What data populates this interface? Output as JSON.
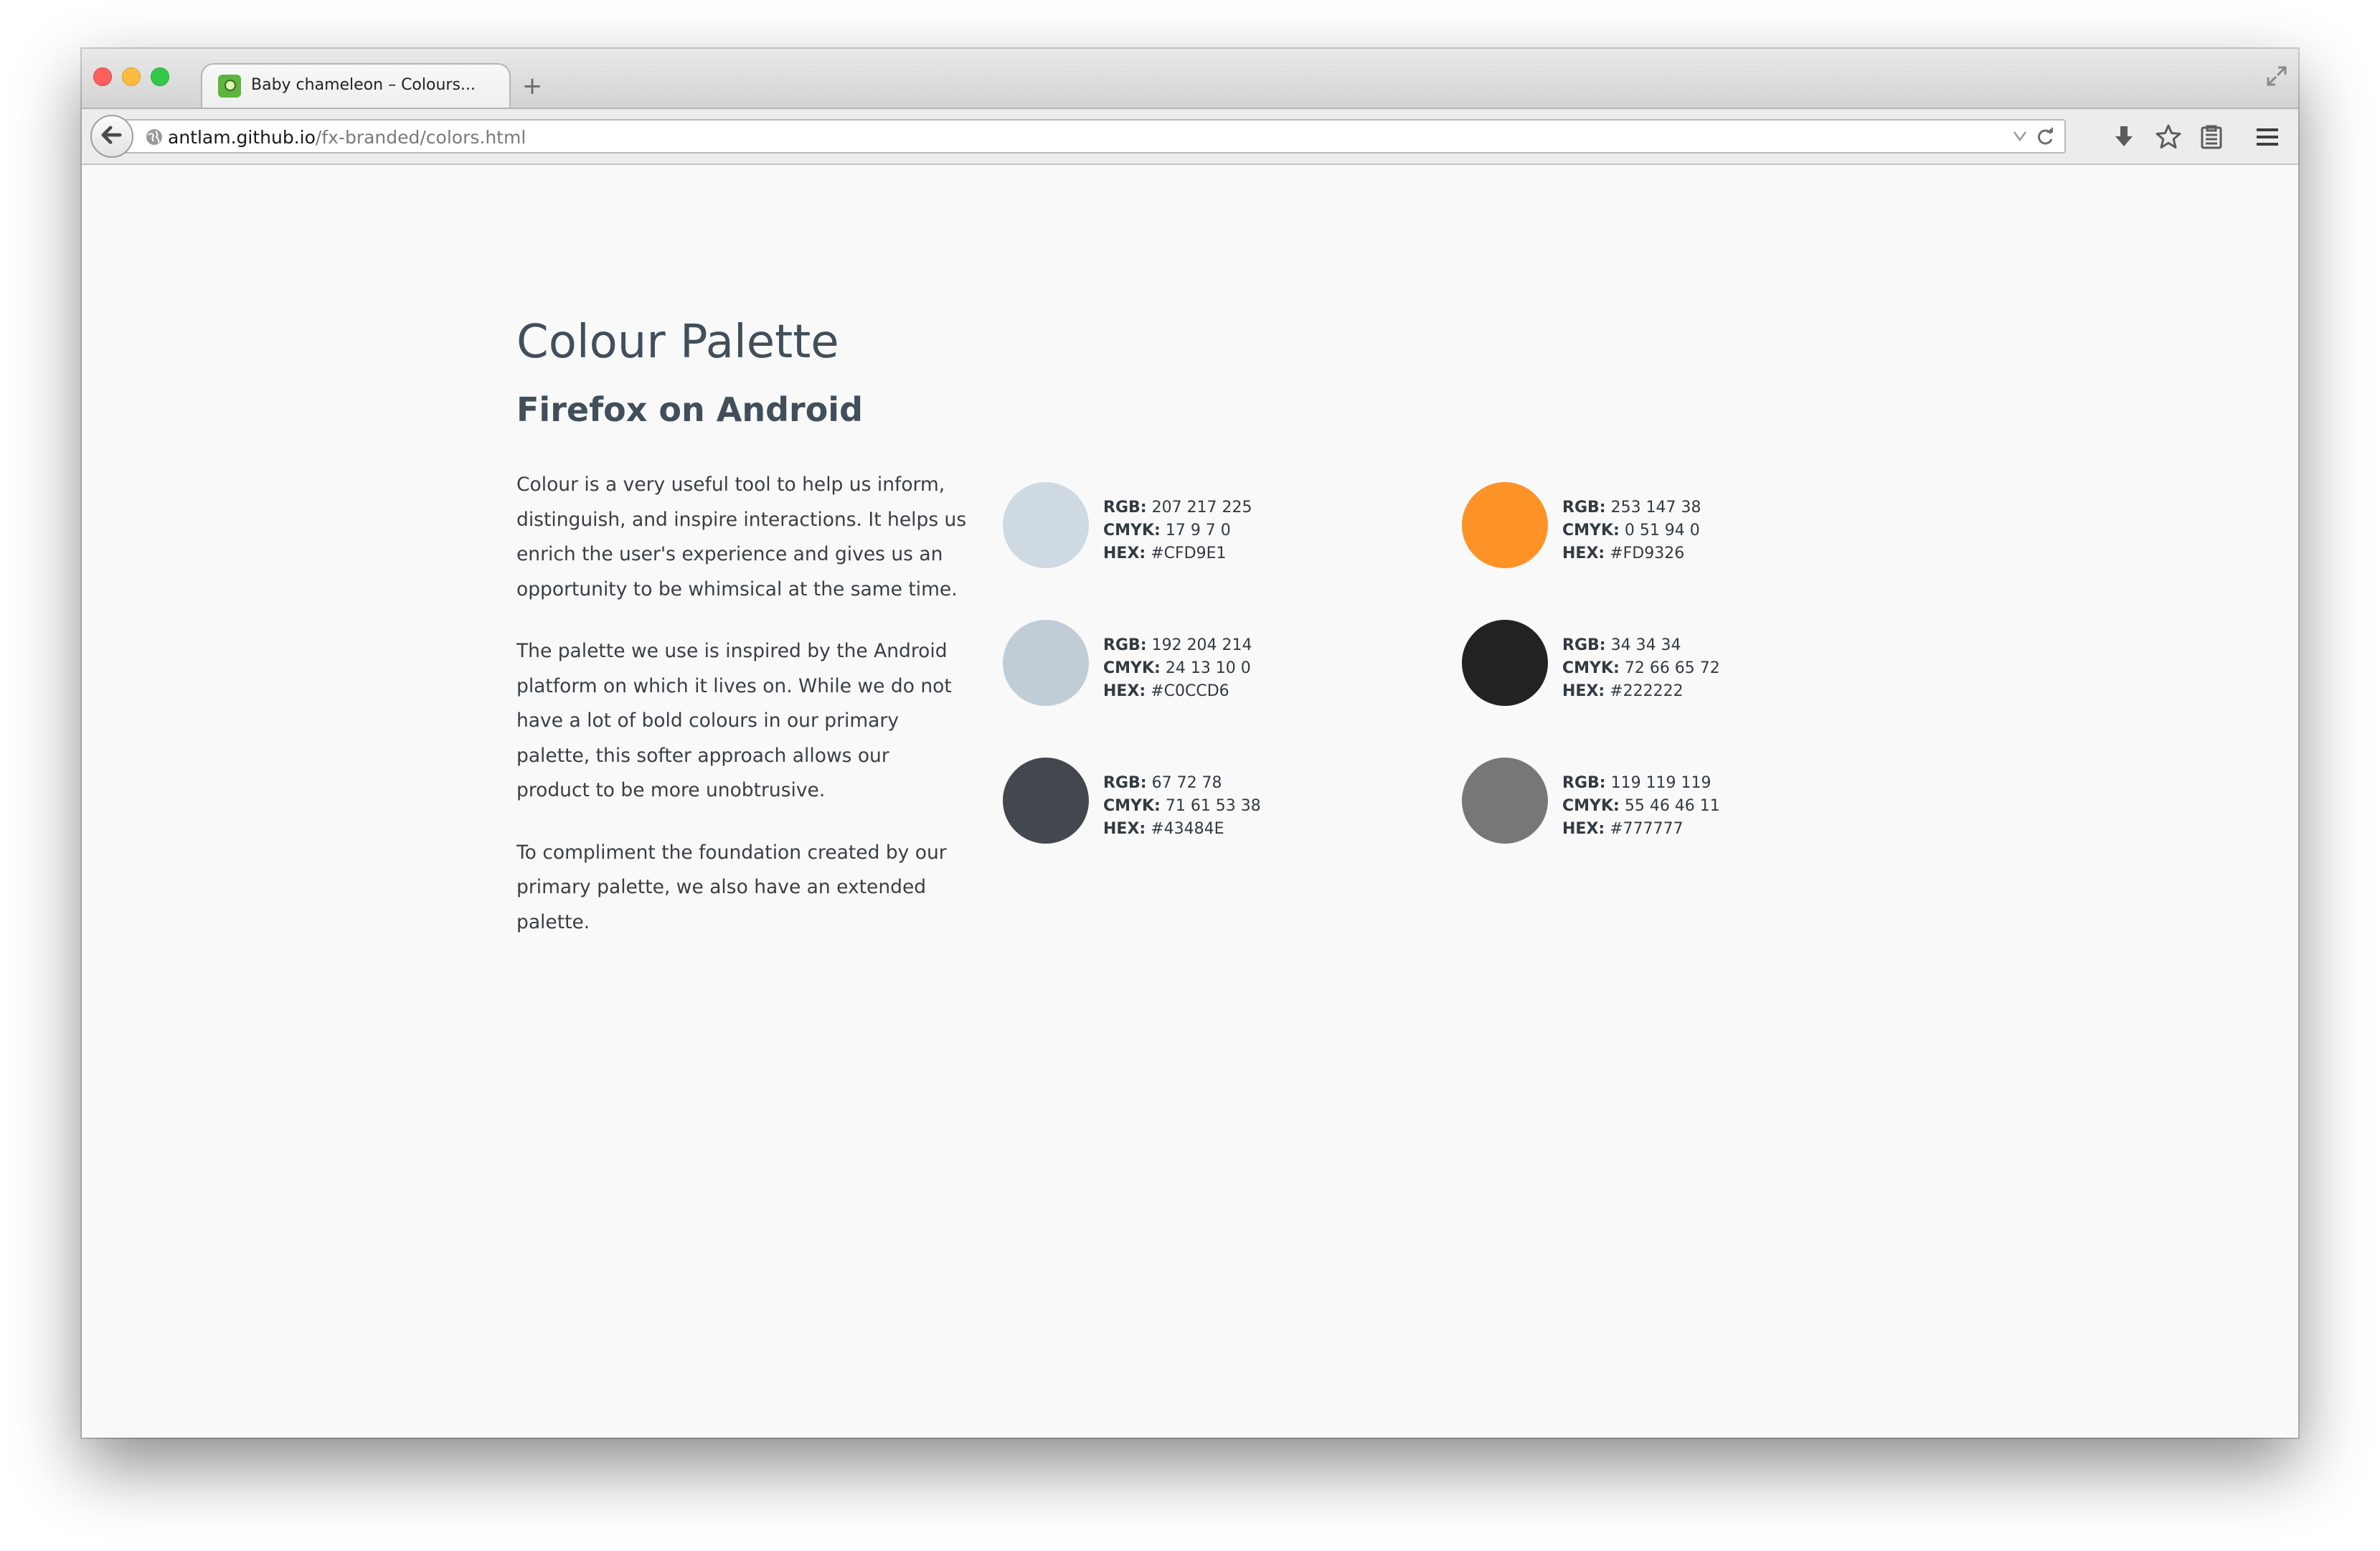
{
  "browser": {
    "tab_title": "Baby chameleon – Colours...",
    "new_tab_label": "+",
    "url_host": "antlam.github.io",
    "url_path": "/fx-branded/colors.html"
  },
  "page": {
    "title": "Colour Palette",
    "subtitle": "Firefox on Android",
    "paragraphs": [
      "Colour is a very useful tool to help us inform, distinguish, and inspire interactions. It helps us enrich the user's experience and gives us an opportunity to be whimsical at the same time.",
      "The palette we use is inspired by the Android platform on which it lives on. While we do not have a lot of bold colours in our primary palette, this softer approach allows our product to be more unobtrusive.",
      "To compliment the foundation created by our primary palette, we also have an extended palette."
    ]
  },
  "labels": {
    "rgb": "RGB:",
    "cmyk": "CMYK:",
    "hex": "HEX:"
  },
  "swatches": [
    {
      "color": "#CFD9E1",
      "rgb": "207 217 225",
      "cmyk": "17 9 7 0",
      "hex": "#CFD9E1"
    },
    {
      "color": "#FD9326",
      "rgb": "253 147 38",
      "cmyk": "0 51 94 0",
      "hex": "#FD9326"
    },
    {
      "color": "#C0CCD6",
      "rgb": "192 204 214",
      "cmyk": "24 13 10 0",
      "hex": "#C0CCD6"
    },
    {
      "color": "#222222",
      "rgb": "34 34 34",
      "cmyk": "72 66 65 72",
      "hex": "#222222"
    },
    {
      "color": "#43484E",
      "rgb": "67 72 78",
      "cmyk": "71 61 53 38",
      "hex": "#43484E"
    },
    {
      "color": "#777777",
      "rgb": "119 119 119",
      "cmyk": "55 46 46 11",
      "hex": "#777777"
    }
  ]
}
